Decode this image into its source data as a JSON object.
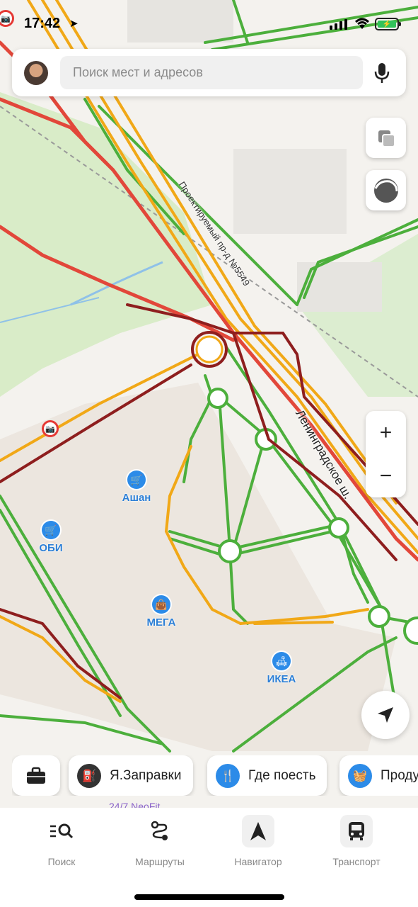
{
  "status_bar": {
    "time": "17:42"
  },
  "search": {
    "placeholder": "Поиск мест и адресов"
  },
  "map": {
    "road_labels": {
      "proezd": "Проектируемый пр-д №5549",
      "shosse": "Ленинградское ш."
    },
    "pois": [
      {
        "name": "Ашан",
        "icon": "cart-icon"
      },
      {
        "name": "ОБИ",
        "icon": "cart-icon"
      },
      {
        "name": "МЕГА",
        "icon": "bag-icon"
      },
      {
        "name": "ИКЕА",
        "icon": "sofa-icon"
      }
    ],
    "bottom_poi": "24/7 NeoFit",
    "colors": {
      "traffic_free": "#4caf3c",
      "traffic_slow": "#f1a817",
      "traffic_jam": "#e2473a",
      "traffic_heavy": "#8e1e1e",
      "poi": "#2c8be8"
    }
  },
  "controls": {
    "zoom_in": "+",
    "zoom_out": "−"
  },
  "chips": [
    {
      "label": "",
      "icon": "briefcase-icon"
    },
    {
      "label": "Я.Заправки",
      "icon": "fuel-icon"
    },
    {
      "label": "Где поесть",
      "icon": "fork-knife-icon"
    },
    {
      "label": "Продукты",
      "icon": "basket-icon"
    }
  ],
  "tabs": [
    {
      "label": "Поиск",
      "icon": "search-list-icon"
    },
    {
      "label": "Маршруты",
      "icon": "route-icon"
    },
    {
      "label": "Навигатор",
      "icon": "navigator-arrow-icon"
    },
    {
      "label": "Транспорт",
      "icon": "bus-icon"
    }
  ]
}
